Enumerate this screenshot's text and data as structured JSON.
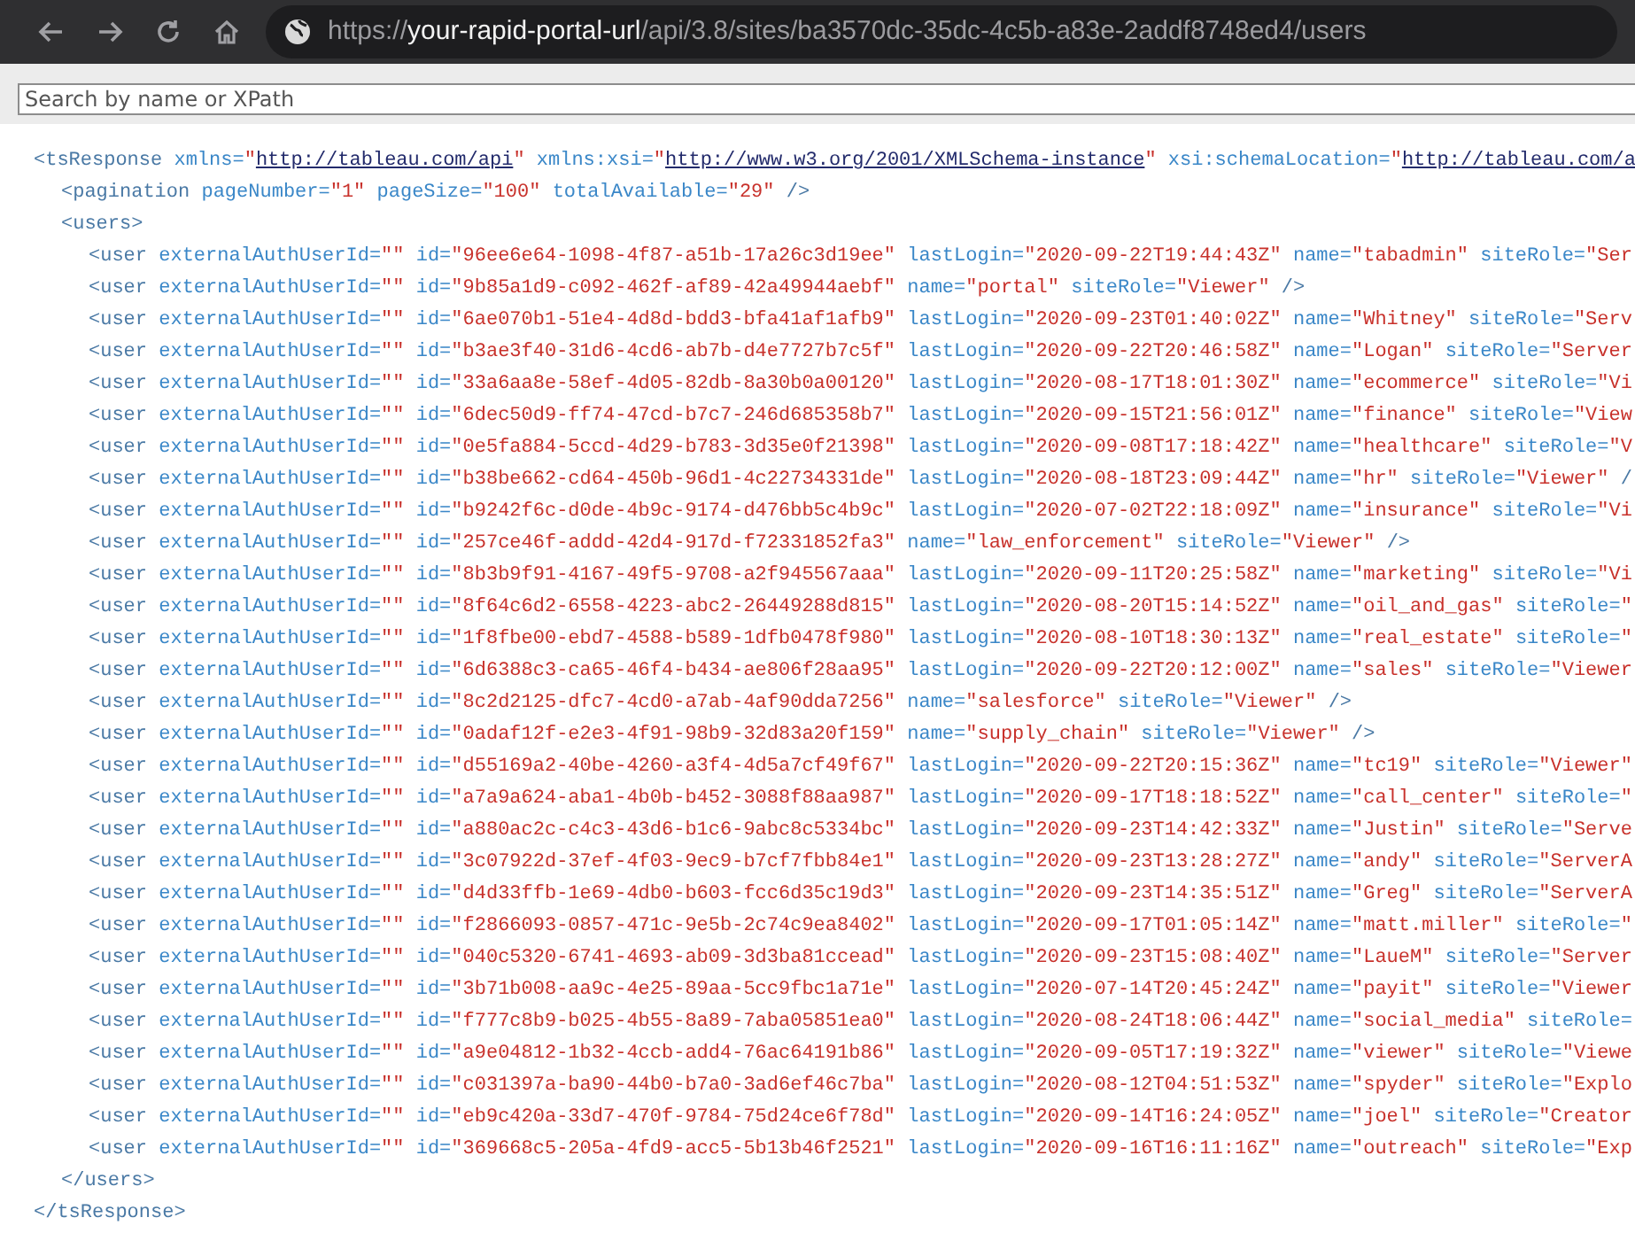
{
  "toolbar": {
    "url": {
      "scheme": "https://",
      "host": "your-rapid-portal-url",
      "path": "/api/3.8/sites/ba3570dc-35dc-4c5b-a83e-2addf8748ed4/users"
    }
  },
  "search": {
    "placeholder": "Search by name or XPath"
  },
  "document": {
    "tag": "<tsResponse",
    "attributes": [
      {
        "name": "xmlns=",
        "value": "\"http://tableau.com/api\"",
        "kind": "link"
      },
      {
        "name": "xmlns:xsi=",
        "value": "\"http://www.w3.org/2001/XMLSchema-instance\"",
        "kind": "link"
      },
      {
        "name": "xsi:schemaLocation=",
        "value": "\"http://tableau.com/a",
        "kind": "link"
      }
    ],
    "children": [
      {
        "tag": "<pagination",
        "attributes": [
          {
            "name": "pageNumber=",
            "value": "\"1\""
          },
          {
            "name": "pageSize=",
            "value": "\"100\""
          },
          {
            "name": "totalAvailable=",
            "value": "\"29\""
          }
        ],
        "end": "/>"
      },
      {
        "tag": "<users",
        "end": ">",
        "close": "</users>",
        "children": [
          {
            "tag": "<user",
            "attributes": [
              {
                "name": "externalAuthUserId=",
                "value": "\"\""
              },
              {
                "name": "id=",
                "value": "\"96ee6e64-1098-4f87-a51b-17a26c3d19ee\""
              },
              {
                "name": "lastLogin=",
                "value": "\"2020-09-22T19:44:43Z\""
              },
              {
                "name": "name=",
                "value": "\"tabadmin\""
              },
              {
                "name": "siteRole=",
                "value": "\"Ser"
              }
            ]
          },
          {
            "tag": "<user",
            "attributes": [
              {
                "name": "externalAuthUserId=",
                "value": "\"\""
              },
              {
                "name": "id=",
                "value": "\"9b85a1d9-c092-462f-af89-42a49944aebf\""
              },
              {
                "name": "name=",
                "value": "\"portal\""
              },
              {
                "name": "siteRole=",
                "value": "\"Viewer\""
              }
            ],
            "end": "/>"
          },
          {
            "tag": "<user",
            "attributes": [
              {
                "name": "externalAuthUserId=",
                "value": "\"\""
              },
              {
                "name": "id=",
                "value": "\"6ae070b1-51e4-4d8d-bdd3-bfa41af1afb9\""
              },
              {
                "name": "lastLogin=",
                "value": "\"2020-09-23T01:40:02Z\""
              },
              {
                "name": "name=",
                "value": "\"Whitney\""
              },
              {
                "name": "siteRole=",
                "value": "\"Serv"
              }
            ]
          },
          {
            "tag": "<user",
            "attributes": [
              {
                "name": "externalAuthUserId=",
                "value": "\"\""
              },
              {
                "name": "id=",
                "value": "\"b3ae3f40-31d6-4cd6-ab7b-d4e7727b7c5f\""
              },
              {
                "name": "lastLogin=",
                "value": "\"2020-09-22T20:46:58Z\""
              },
              {
                "name": "name=",
                "value": "\"Logan\""
              },
              {
                "name": "siteRole=",
                "value": "\"Server"
              }
            ]
          },
          {
            "tag": "<user",
            "attributes": [
              {
                "name": "externalAuthUserId=",
                "value": "\"\""
              },
              {
                "name": "id=",
                "value": "\"33a6aa8e-58ef-4d05-82db-8a30b0a00120\""
              },
              {
                "name": "lastLogin=",
                "value": "\"2020-08-17T18:01:30Z\""
              },
              {
                "name": "name=",
                "value": "\"ecommerce\""
              },
              {
                "name": "siteRole=",
                "value": "\"Vi"
              }
            ]
          },
          {
            "tag": "<user",
            "attributes": [
              {
                "name": "externalAuthUserId=",
                "value": "\"\""
              },
              {
                "name": "id=",
                "value": "\"6dec50d9-ff74-47cd-b7c7-246d685358b7\""
              },
              {
                "name": "lastLogin=",
                "value": "\"2020-09-15T21:56:01Z\""
              },
              {
                "name": "name=",
                "value": "\"finance\""
              },
              {
                "name": "siteRole=",
                "value": "\"View"
              }
            ]
          },
          {
            "tag": "<user",
            "attributes": [
              {
                "name": "externalAuthUserId=",
                "value": "\"\""
              },
              {
                "name": "id=",
                "value": "\"0e5fa884-5ccd-4d29-b783-3d35e0f21398\""
              },
              {
                "name": "lastLogin=",
                "value": "\"2020-09-08T17:18:42Z\""
              },
              {
                "name": "name=",
                "value": "\"healthcare\""
              },
              {
                "name": "siteRole=",
                "value": "\"V"
              }
            ]
          },
          {
            "tag": "<user",
            "attributes": [
              {
                "name": "externalAuthUserId=",
                "value": "\"\""
              },
              {
                "name": "id=",
                "value": "\"b38be662-cd64-450b-96d1-4c22734331de\""
              },
              {
                "name": "lastLogin=",
                "value": "\"2020-08-18T23:09:44Z\""
              },
              {
                "name": "name=",
                "value": "\"hr\""
              },
              {
                "name": "siteRole=",
                "value": "\"Viewer\""
              }
            ],
            "end": "/"
          },
          {
            "tag": "<user",
            "attributes": [
              {
                "name": "externalAuthUserId=",
                "value": "\"\""
              },
              {
                "name": "id=",
                "value": "\"b9242f6c-d0de-4b9c-9174-d476bb5c4b9c\""
              },
              {
                "name": "lastLogin=",
                "value": "\"2020-07-02T22:18:09Z\""
              },
              {
                "name": "name=",
                "value": "\"insurance\""
              },
              {
                "name": "siteRole=",
                "value": "\"Vi"
              }
            ]
          },
          {
            "tag": "<user",
            "attributes": [
              {
                "name": "externalAuthUserId=",
                "value": "\"\""
              },
              {
                "name": "id=",
                "value": "\"257ce46f-addd-42d4-917d-f72331852fa3\""
              },
              {
                "name": "name=",
                "value": "\"law_enforcement\""
              },
              {
                "name": "siteRole=",
                "value": "\"Viewer\""
              }
            ],
            "end": "/>"
          },
          {
            "tag": "<user",
            "attributes": [
              {
                "name": "externalAuthUserId=",
                "value": "\"\""
              },
              {
                "name": "id=",
                "value": "\"8b3b9f91-4167-49f5-9708-a2f945567aaa\""
              },
              {
                "name": "lastLogin=",
                "value": "\"2020-09-11T20:25:58Z\""
              },
              {
                "name": "name=",
                "value": "\"marketing\""
              },
              {
                "name": "siteRole=",
                "value": "\"Vi"
              }
            ]
          },
          {
            "tag": "<user",
            "attributes": [
              {
                "name": "externalAuthUserId=",
                "value": "\"\""
              },
              {
                "name": "id=",
                "value": "\"8f64c6d2-6558-4223-abc2-26449288d815\""
              },
              {
                "name": "lastLogin=",
                "value": "\"2020-08-20T15:14:52Z\""
              },
              {
                "name": "name=",
                "value": "\"oil_and_gas\""
              },
              {
                "name": "siteRole=",
                "value": "\""
              }
            ]
          },
          {
            "tag": "<user",
            "attributes": [
              {
                "name": "externalAuthUserId=",
                "value": "\"\""
              },
              {
                "name": "id=",
                "value": "\"1f8fbe00-ebd7-4588-b589-1dfb0478f980\""
              },
              {
                "name": "lastLogin=",
                "value": "\"2020-08-10T18:30:13Z\""
              },
              {
                "name": "name=",
                "value": "\"real_estate\""
              },
              {
                "name": "siteRole=",
                "value": "\""
              }
            ]
          },
          {
            "tag": "<user",
            "attributes": [
              {
                "name": "externalAuthUserId=",
                "value": "\"\""
              },
              {
                "name": "id=",
                "value": "\"6d6388c3-ca65-46f4-b434-ae806f28aa95\""
              },
              {
                "name": "lastLogin=",
                "value": "\"2020-09-22T20:12:00Z\""
              },
              {
                "name": "name=",
                "value": "\"sales\""
              },
              {
                "name": "siteRole=",
                "value": "\"Viewer"
              }
            ]
          },
          {
            "tag": "<user",
            "attributes": [
              {
                "name": "externalAuthUserId=",
                "value": "\"\""
              },
              {
                "name": "id=",
                "value": "\"8c2d2125-dfc7-4cd0-a7ab-4af90dda7256\""
              },
              {
                "name": "name=",
                "value": "\"salesforce\""
              },
              {
                "name": "siteRole=",
                "value": "\"Viewer\""
              }
            ],
            "end": "/>"
          },
          {
            "tag": "<user",
            "attributes": [
              {
                "name": "externalAuthUserId=",
                "value": "\"\""
              },
              {
                "name": "id=",
                "value": "\"0adaf12f-e2e3-4f91-98b9-32d83a20f159\""
              },
              {
                "name": "name=",
                "value": "\"supply_chain\""
              },
              {
                "name": "siteRole=",
                "value": "\"Viewer\""
              }
            ],
            "end": "/>"
          },
          {
            "tag": "<user",
            "attributes": [
              {
                "name": "externalAuthUserId=",
                "value": "\"\""
              },
              {
                "name": "id=",
                "value": "\"d55169a2-40be-4260-a3f4-4d5a7cf49f67\""
              },
              {
                "name": "lastLogin=",
                "value": "\"2020-09-22T20:15:36Z\""
              },
              {
                "name": "name=",
                "value": "\"tc19\""
              },
              {
                "name": "siteRole=",
                "value": "\"Viewer\""
              }
            ]
          },
          {
            "tag": "<user",
            "attributes": [
              {
                "name": "externalAuthUserId=",
                "value": "\"\""
              },
              {
                "name": "id=",
                "value": "\"a7a9a624-aba1-4b0b-b452-3088f88aa987\""
              },
              {
                "name": "lastLogin=",
                "value": "\"2020-09-17T18:18:52Z\""
              },
              {
                "name": "name=",
                "value": "\"call_center\""
              },
              {
                "name": "siteRole=",
                "value": "\""
              }
            ]
          },
          {
            "tag": "<user",
            "attributes": [
              {
                "name": "externalAuthUserId=",
                "value": "\"\""
              },
              {
                "name": "id=",
                "value": "\"a880ac2c-c4c3-43d6-b1c6-9abc8c5334bc\""
              },
              {
                "name": "lastLogin=",
                "value": "\"2020-09-23T14:42:33Z\""
              },
              {
                "name": "name=",
                "value": "\"Justin\""
              },
              {
                "name": "siteRole=",
                "value": "\"Serve"
              }
            ]
          },
          {
            "tag": "<user",
            "attributes": [
              {
                "name": "externalAuthUserId=",
                "value": "\"\""
              },
              {
                "name": "id=",
                "value": "\"3c07922d-37ef-4f03-9ec9-b7cf7fbb84e1\""
              },
              {
                "name": "lastLogin=",
                "value": "\"2020-09-23T13:28:27Z\""
              },
              {
                "name": "name=",
                "value": "\"andy\""
              },
              {
                "name": "siteRole=",
                "value": "\"ServerA"
              }
            ]
          },
          {
            "tag": "<user",
            "attributes": [
              {
                "name": "externalAuthUserId=",
                "value": "\"\""
              },
              {
                "name": "id=",
                "value": "\"d4d33ffb-1e69-4db0-b603-fcc6d35c19d3\""
              },
              {
                "name": "lastLogin=",
                "value": "\"2020-09-23T14:35:51Z\""
              },
              {
                "name": "name=",
                "value": "\"Greg\""
              },
              {
                "name": "siteRole=",
                "value": "\"ServerA"
              }
            ]
          },
          {
            "tag": "<user",
            "attributes": [
              {
                "name": "externalAuthUserId=",
                "value": "\"\""
              },
              {
                "name": "id=",
                "value": "\"f2866093-0857-471c-9e5b-2c74c9ea8402\""
              },
              {
                "name": "lastLogin=",
                "value": "\"2020-09-17T01:05:14Z\""
              },
              {
                "name": "name=",
                "value": "\"matt.miller\""
              },
              {
                "name": "siteRole=",
                "value": "\""
              }
            ]
          },
          {
            "tag": "<user",
            "attributes": [
              {
                "name": "externalAuthUserId=",
                "value": "\"\""
              },
              {
                "name": "id=",
                "value": "\"040c5320-6741-4693-ab09-3d3ba81ccead\""
              },
              {
                "name": "lastLogin=",
                "value": "\"2020-09-23T15:08:40Z\""
              },
              {
                "name": "name=",
                "value": "\"LaueM\""
              },
              {
                "name": "siteRole=",
                "value": "\"Server"
              }
            ]
          },
          {
            "tag": "<user",
            "attributes": [
              {
                "name": "externalAuthUserId=",
                "value": "\"\""
              },
              {
                "name": "id=",
                "value": "\"3b71b008-aa9c-4e25-89aa-5cc9fbc1a71e\""
              },
              {
                "name": "lastLogin=",
                "value": "\"2020-07-14T20:45:24Z\""
              },
              {
                "name": "name=",
                "value": "\"payit\""
              },
              {
                "name": "siteRole=",
                "value": "\"Viewer"
              }
            ]
          },
          {
            "tag": "<user",
            "attributes": [
              {
                "name": "externalAuthUserId=",
                "value": "\"\""
              },
              {
                "name": "id=",
                "value": "\"f777c8b9-b025-4b55-8a89-7aba05851ea0\""
              },
              {
                "name": "lastLogin=",
                "value": "\"2020-08-24T18:06:44Z\""
              },
              {
                "name": "name=",
                "value": "\"social_media\""
              },
              {
                "name": "siteRole="
              }
            ]
          },
          {
            "tag": "<user",
            "attributes": [
              {
                "name": "externalAuthUserId=",
                "value": "\"\""
              },
              {
                "name": "id=",
                "value": "\"a9e04812-1b32-4ccb-add4-76ac64191b86\""
              },
              {
                "name": "lastLogin=",
                "value": "\"2020-09-05T17:19:32Z\""
              },
              {
                "name": "name=",
                "value": "\"viewer\""
              },
              {
                "name": "siteRole=",
                "value": "\"Viewe"
              }
            ]
          },
          {
            "tag": "<user",
            "attributes": [
              {
                "name": "externalAuthUserId=",
                "value": "\"\""
              },
              {
                "name": "id=",
                "value": "\"c031397a-ba90-44b0-b7a0-3ad6ef46c7ba\""
              },
              {
                "name": "lastLogin=",
                "value": "\"2020-08-12T04:51:53Z\""
              },
              {
                "name": "name=",
                "value": "\"spyder\""
              },
              {
                "name": "siteRole=",
                "value": "\"Explo"
              }
            ]
          },
          {
            "tag": "<user",
            "attributes": [
              {
                "name": "externalAuthUserId=",
                "value": "\"\""
              },
              {
                "name": "id=",
                "value": "\"eb9c420a-33d7-470f-9784-75d24ce6f78d\""
              },
              {
                "name": "lastLogin=",
                "value": "\"2020-09-14T16:24:05Z\""
              },
              {
                "name": "name=",
                "value": "\"joel\""
              },
              {
                "name": "siteRole=",
                "value": "\"Creator"
              }
            ]
          },
          {
            "tag": "<user",
            "attributes": [
              {
                "name": "externalAuthUserId=",
                "value": "\"\""
              },
              {
                "name": "id=",
                "value": "\"369668c5-205a-4fd9-acc5-5b13b46f2521\""
              },
              {
                "name": "lastLogin=",
                "value": "\"2020-09-16T16:11:16Z\""
              },
              {
                "name": "name=",
                "value": "\"outreach\""
              },
              {
                "name": "siteRole=",
                "value": "\"Exp"
              }
            ]
          }
        ]
      }
    ],
    "close": "</tsResponse>"
  }
}
